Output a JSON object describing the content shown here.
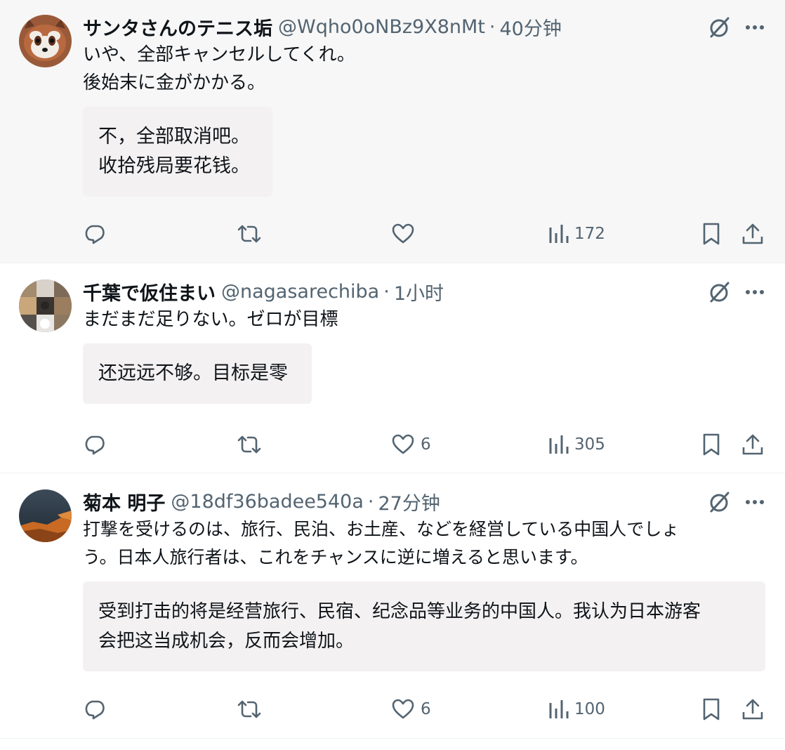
{
  "tweets": [
    {
      "name": "サンタさんのテニス垢",
      "handle": "@Wqho0oNBz9X8nMt",
      "dot": "·",
      "time": "40分钟",
      "text_lines": [
        "いや、全部キャンセルしてくれ。",
        "後始末に金がかかる。"
      ],
      "translation_lines": [
        "不，全部取消吧。",
        "收拾残局要花钱。"
      ],
      "replies": "",
      "retweets": "",
      "likes": "",
      "views": "172"
    },
    {
      "name": "千葉で仮住まい",
      "handle": "@nagasarechiba",
      "dot": "·",
      "time": "1小时",
      "text_lines": [
        "まだまだ足りない。ゼロが目標"
      ],
      "translation_lines": [
        "还远远不够。目标是零"
      ],
      "replies": "",
      "retweets": "",
      "likes": "6",
      "views": "305"
    },
    {
      "name": "菊本 明子",
      "handle": "@18df36badee540a",
      "dot": "·",
      "time": "27分钟",
      "text_lines": [
        "打撃を受けるのは、旅行、民泊、お土産、などを経営している中国人でしょ",
        "う。日本人旅行者は、これをチャンスに逆に増えると思います。"
      ],
      "translation_lines": [
        "受到打击的将是经营旅行、民宿、纪念品等业务的中国人。我认为日本游客",
        "会把这当成机会，反而会增加。"
      ],
      "replies": "",
      "retweets": "",
      "likes": "6",
      "views": "100"
    }
  ],
  "icons": {
    "grok": "grok-slash-icon",
    "more": "more-dots-icon",
    "reply": "reply-bubble-icon",
    "retweet": "retweet-arrows-icon",
    "like": "heart-icon",
    "views": "views-bars-icon",
    "bookmark": "bookmark-icon",
    "share": "share-upload-icon"
  },
  "colors": {
    "text": "#0f1419",
    "muted": "#536471",
    "highlight_bg": "#f7f7f7",
    "translation_bg": "#f3f1f1"
  }
}
